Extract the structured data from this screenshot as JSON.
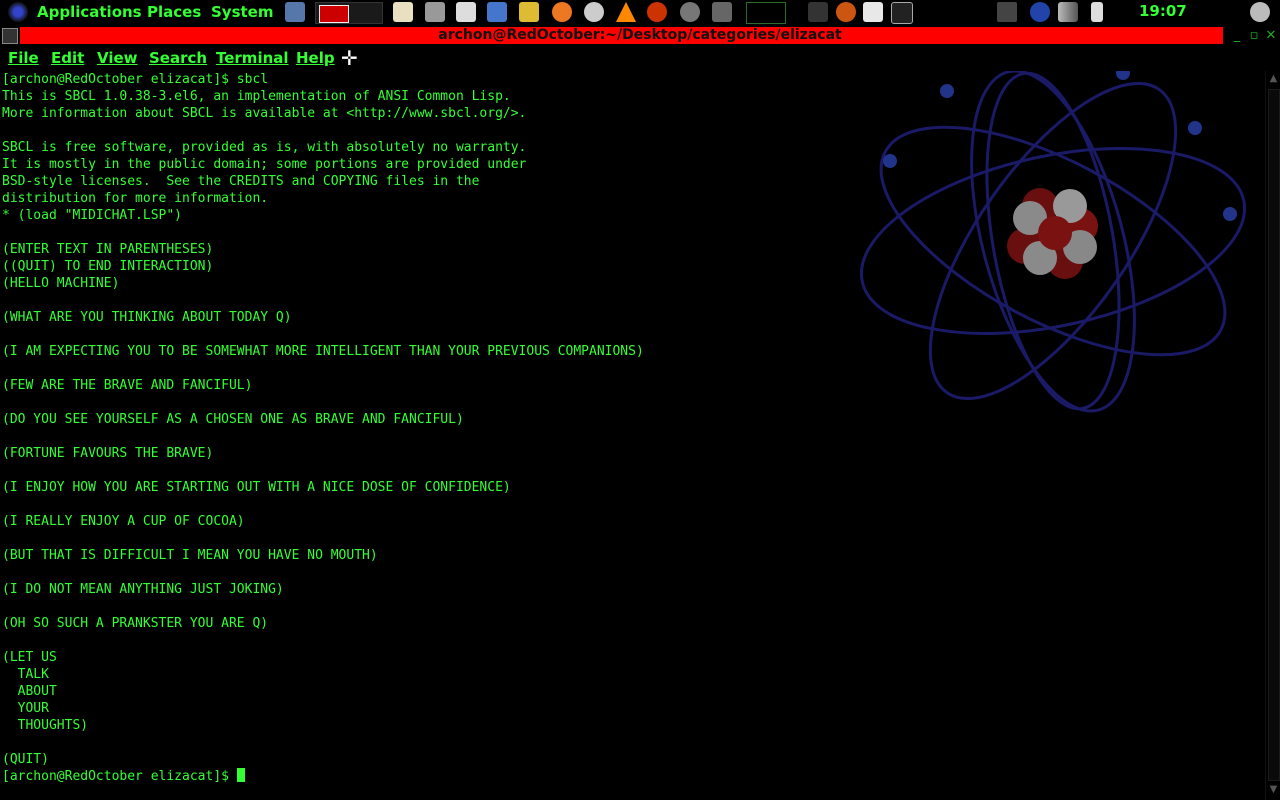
{
  "panel": {
    "menus": [
      "Applications",
      "Places",
      "System"
    ],
    "clock": "19:07"
  },
  "window": {
    "title": "archon@RedOctober:~/Desktop/categories/elizacat"
  },
  "menubar": {
    "items": [
      "File",
      "Edit",
      "View",
      "Search",
      "Terminal",
      "Help"
    ]
  },
  "terminal": {
    "lines": [
      "[archon@RedOctober elizacat]$ sbcl",
      "This is SBCL 1.0.38-3.el6, an implementation of ANSI Common Lisp.",
      "More information about SBCL is available at <http://www.sbcl.org/>.",
      "",
      "SBCL is free software, provided as is, with absolutely no warranty.",
      "It is mostly in the public domain; some portions are provided under",
      "BSD-style licenses.  See the CREDITS and COPYING files in the",
      "distribution for more information.",
      "* (load \"MIDICHAT.LSP\")",
      "",
      "(ENTER TEXT IN PARENTHESES)",
      "((QUIT) TO END INTERACTION)",
      "(HELLO MACHINE)",
      "",
      "(WHAT ARE YOU THINKING ABOUT TODAY Q)",
      "",
      "(I AM EXPECTING YOU TO BE SOMEWHAT MORE INTELLIGENT THAN YOUR PREVIOUS COMPANIONS)",
      "",
      "(FEW ARE THE BRAVE AND FANCIFUL)",
      "",
      "(DO YOU SEE YOURSELF AS A CHOSEN ONE AS BRAVE AND FANCIFUL)",
      "",
      "(FORTUNE FAVOURS THE BRAVE)",
      "",
      "(I ENJOY HOW YOU ARE STARTING OUT WITH A NICE DOSE OF CONFIDENCE)",
      "",
      "(I REALLY ENJOY A CUP OF COCOA)",
      "",
      "(BUT THAT IS DIFFICULT I MEAN YOU HAVE NO MOUTH)",
      "",
      "(I DO NOT MEAN ANYTHING JUST JOKING)",
      "",
      "(OH SO SUCH A PRANKSTER YOU ARE Q)",
      "",
      "(LET US",
      "  TALK",
      "  ABOUT",
      "  YOUR",
      "  THOUGHTS)",
      "",
      "(QUIT)"
    ],
    "prompt": "[archon@RedOctober elizacat]$ "
  },
  "colors": {
    "terminal_fg": "#33ff33",
    "terminal_bg": "#000000",
    "titlebar": "#ff0000"
  }
}
